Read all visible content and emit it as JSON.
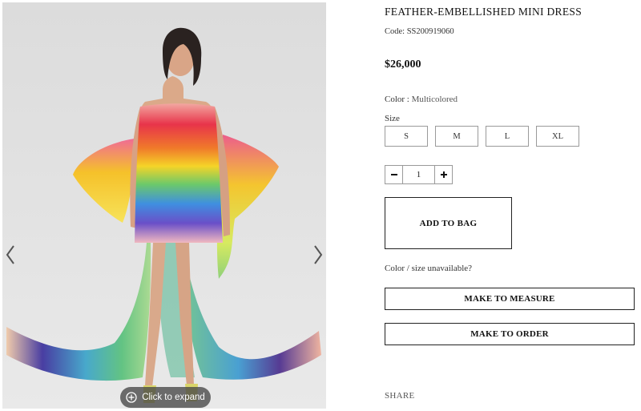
{
  "product": {
    "title": "FEATHER-EMBELLISHED MINI DRESS",
    "code_label": "Code: ",
    "code": "SS200919060",
    "price": "$26,000",
    "color_label": "Color : ",
    "color_value": "Multicolored",
    "size_label": "Size",
    "sizes": [
      "S",
      "M",
      "L",
      "XL"
    ],
    "quantity": "1",
    "add_to_bag": "ADD TO BAG",
    "unavailable_text": "Color / size unavailable?",
    "make_to_measure": "MAKE TO MEASURE",
    "make_to_order": "MAKE TO ORDER",
    "share": "SHARE"
  },
  "gallery": {
    "expand_label": "Click to expand",
    "prev_icon": "chevron-left-icon",
    "next_icon": "chevron-right-icon",
    "expand_icon": "plus-circle-icon"
  },
  "colors": {
    "border": "#9a9a9a",
    "text": "#222222",
    "pill_bg": "#464646"
  }
}
